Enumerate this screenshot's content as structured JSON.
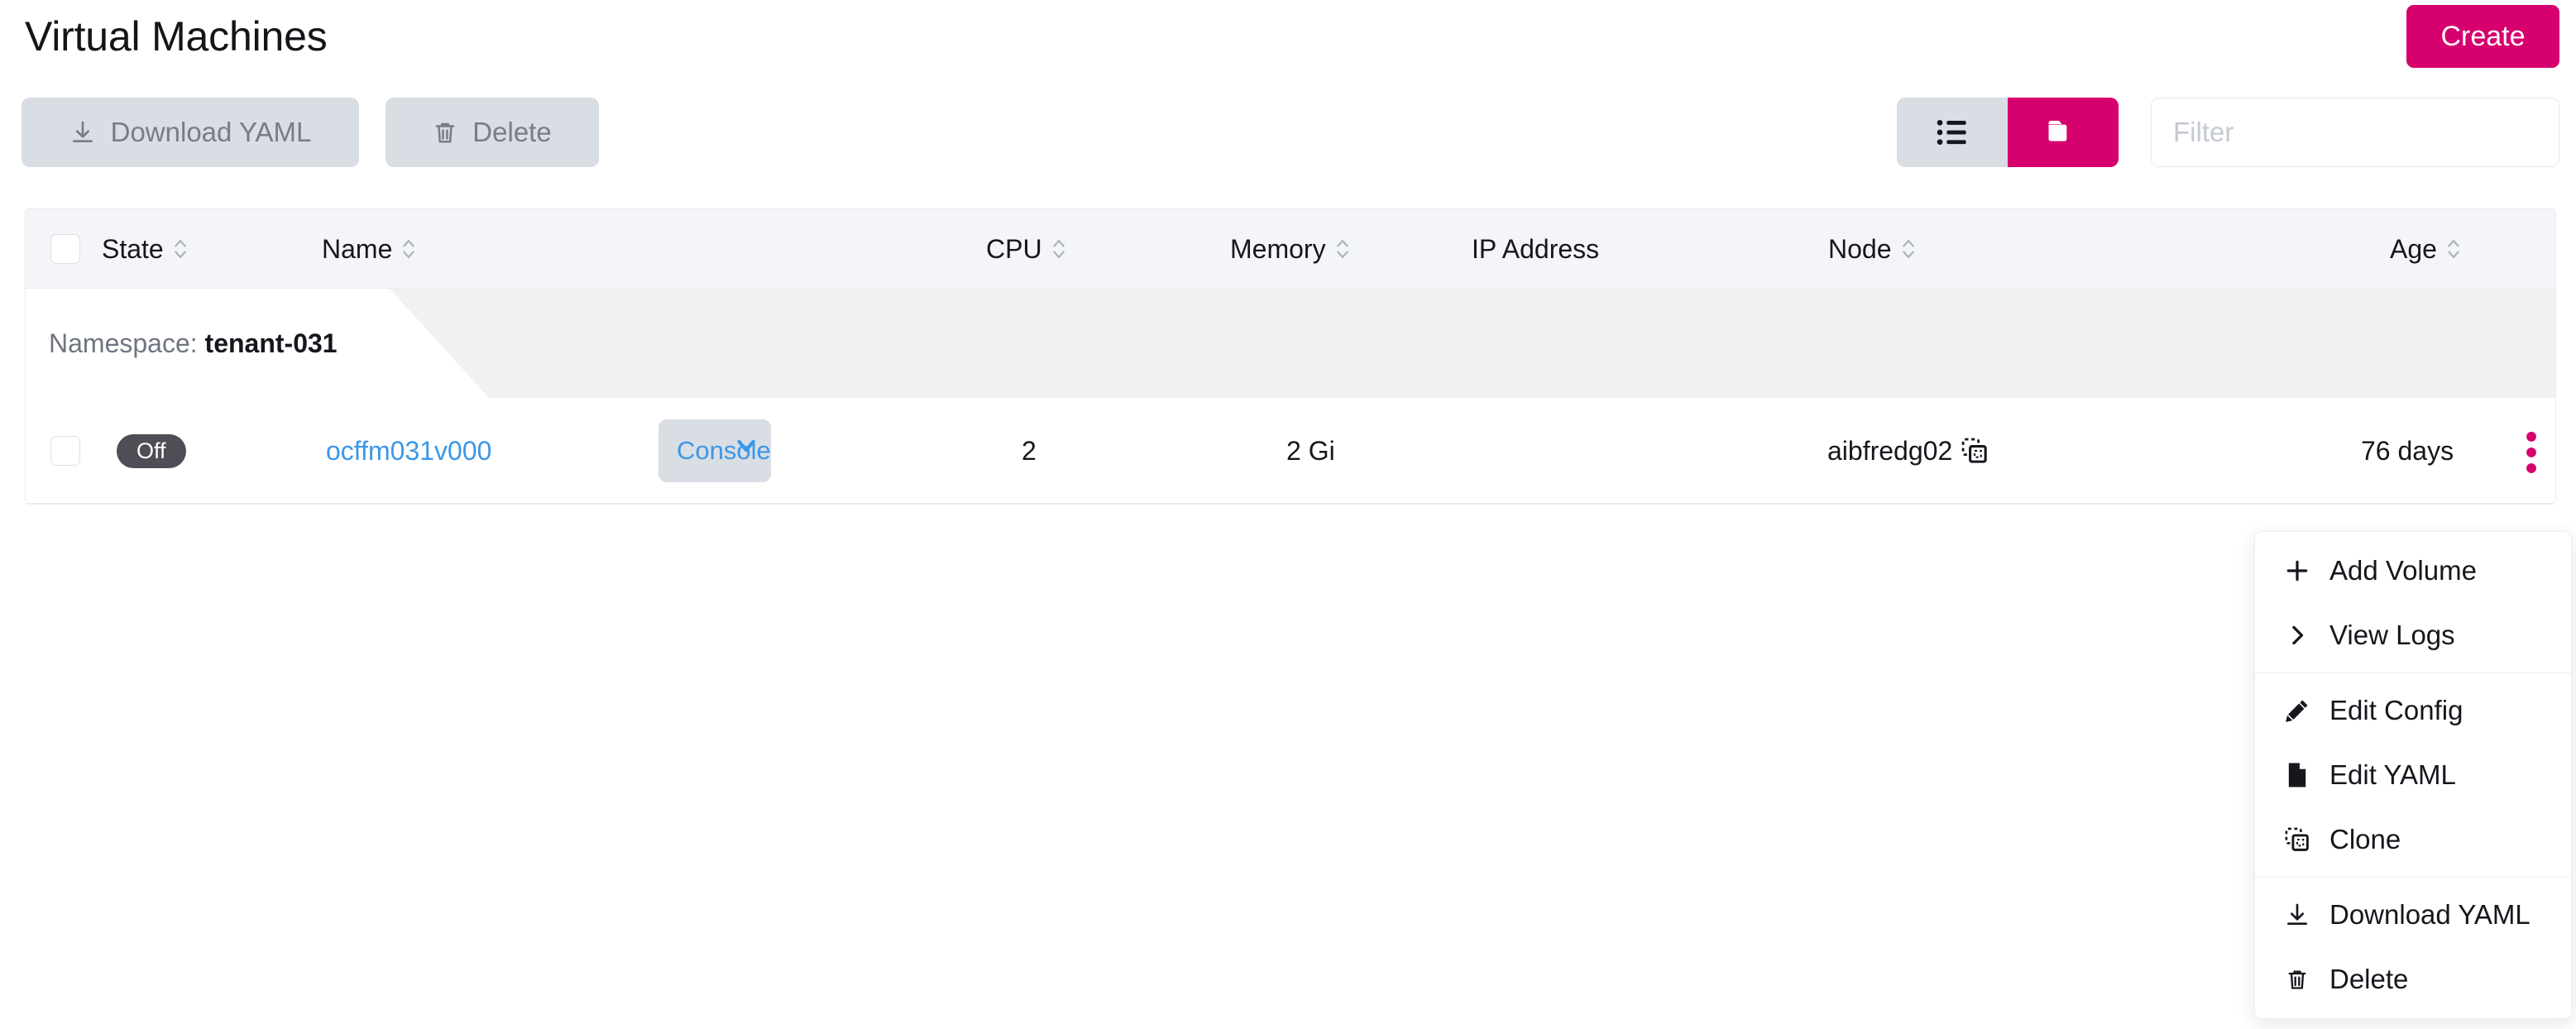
{
  "header": {
    "title": "Virtual Machines",
    "create_label": "Create"
  },
  "toolbar": {
    "download_yaml_label": "Download YAML",
    "delete_label": "Delete",
    "view_toggle": {
      "list_icon": "list-icon",
      "folder_icon": "folder-icon",
      "active": "folder"
    },
    "filter_placeholder": "Filter",
    "filter_value": ""
  },
  "table": {
    "columns": [
      {
        "key": "state",
        "label": "State",
        "sortable": true
      },
      {
        "key": "name",
        "label": "Name",
        "sortable": true
      },
      {
        "key": "console",
        "label": "",
        "sortable": false
      },
      {
        "key": "cpu",
        "label": "CPU",
        "sortable": true
      },
      {
        "key": "memory",
        "label": "Memory",
        "sortable": true
      },
      {
        "key": "ip",
        "label": "IP Address",
        "sortable": false
      },
      {
        "key": "node",
        "label": "Node",
        "sortable": true
      },
      {
        "key": "age",
        "label": "Age",
        "sortable": true
      }
    ],
    "group": {
      "label": "Namespace:",
      "value": "tenant-031"
    },
    "rows": [
      {
        "state": "Off",
        "name": "ocffm031v000",
        "console_label": "Console",
        "cpu": "2",
        "memory": "2 Gi",
        "ip": "",
        "node": "aibfredg02",
        "node_copy_icon": "clone-icon",
        "age": "76 days",
        "actions_icon": "kebab-menu-icon"
      }
    ]
  },
  "context_menu": {
    "items": [
      {
        "label": "Add Volume",
        "icon": "plus-icon"
      },
      {
        "label": "View Logs",
        "icon": "chevron-right-icon"
      },
      {
        "separator": true
      },
      {
        "label": "Edit Config",
        "icon": "pencil-icon"
      },
      {
        "label": "Edit YAML",
        "icon": "file-icon"
      },
      {
        "label": "Clone",
        "icon": "clone-icon"
      },
      {
        "separator": true
      },
      {
        "label": "Download YAML",
        "icon": "download-icon"
      },
      {
        "label": "Delete",
        "icon": "trash-icon"
      }
    ]
  },
  "colors": {
    "accent": "#d6006e",
    "link": "#3a97e8",
    "badge_bg": "#4e4e56",
    "button_bg": "#d9dde4",
    "header_bg": "#f3f5f9"
  }
}
